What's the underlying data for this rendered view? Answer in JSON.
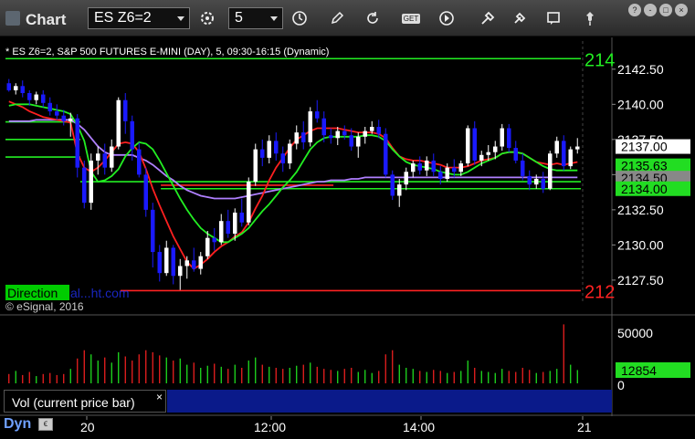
{
  "app": {
    "title": "Chart"
  },
  "toolbar": {
    "symbol_value": "ES Z6=2",
    "interval_value": "5",
    "icons": [
      "settings-icon",
      "clock-icon",
      "pencil-icon",
      "refresh-icon",
      "get-icon",
      "play-icon",
      "tools-icon",
      "comment-icon",
      "pin-icon"
    ],
    "get_label": "GET",
    "window_controls": [
      "?",
      "-",
      "□",
      "×"
    ]
  },
  "chart_header": "* ES Z6=2, S&P 500 FUTURES E-MINI (DAY), 5, 09:30-16:15 (Dynamic)",
  "copyright": "© eSignal, 2016",
  "watermark": {
    "box": "Direction",
    "rest": "al...ht.com"
  },
  "price_axis": {
    "ticks": [
      "2142.50",
      "2140.00",
      "2137.50",
      "2135.00",
      "2132.50",
      "2130.00",
      "2127.50"
    ],
    "tick_values": [
      2142.5,
      2140,
      2137.5,
      2135,
      2132.5,
      2130,
      2127.5
    ]
  },
  "price_tags": [
    {
      "label": "2137.00",
      "value": 2137.0,
      "bg": "#ffffff",
      "fg": "#000000"
    },
    {
      "label": "2135.63",
      "value": 2135.63,
      "bg": "#22dd22",
      "fg": "#000000"
    },
    {
      "label": "2134.50",
      "value": 2134.75,
      "bg": "#888888",
      "fg": "#000000"
    },
    {
      "label": "2134.00",
      "value": 2134.0,
      "bg": "#22dd22",
      "fg": "#000000"
    }
  ],
  "right_edge_labels": [
    {
      "label": "214",
      "value": 2143.25,
      "color": "#22ee22"
    },
    {
      "label": "212",
      "value": 2126.75,
      "color": "#ff2222"
    }
  ],
  "volume_axis": {
    "ticks": [
      "50000",
      "0"
    ],
    "current_label": "12854",
    "current_value": 12854
  },
  "vol_title": "Vol (current price bar)",
  "vol_close": "×",
  "time_axis": {
    "labels": [
      "20",
      "12:00",
      "14:00",
      "21"
    ]
  },
  "dyn_label": "Dyn",
  "colors": {
    "up": "#ffffff",
    "down": "#1a1aff",
    "ma_red": "#ff2020",
    "ma_green": "#22ee22",
    "ma_violet": "#b080ff",
    "ma_gray": "#aaaaaa",
    "level_green": "#22ee22",
    "level_red": "#ff2222"
  },
  "chart_data": {
    "type": "candlestick",
    "price_range": [
      2126.0,
      2144.5
    ],
    "volume_range": [
      0,
      60000
    ],
    "levels": [
      {
        "value": 2143.25,
        "color": "#22ee22",
        "from": 0.0
      },
      {
        "value": 2126.75,
        "color": "#ff2222",
        "from": 0.2
      },
      {
        "value": 2138.75,
        "color": "#22ee22",
        "from": 0.0,
        "to": 0.13
      },
      {
        "value": 2137.5,
        "color": "#22ee22",
        "from": 0.0,
        "to": 0.13
      },
      {
        "value": 2136.25,
        "color": "#22ee22",
        "from": 0.0,
        "to": 0.13
      },
      {
        "value": 2134.5,
        "color": "#22ee22",
        "from": 0.13
      },
      {
        "value": 2134.0,
        "color": "#22ee22",
        "from": 0.27
      },
      {
        "value": 2134.25,
        "color": "#ff2222",
        "from": 0.27,
        "to": 0.57
      }
    ],
    "bars": [
      [
        2141.5,
        2141.8,
        2140.9,
        2141.0
      ],
      [
        2141.0,
        2141.5,
        2140.7,
        2141.3
      ],
      [
        2141.3,
        2141.7,
        2140.5,
        2140.8
      ],
      [
        2140.8,
        2141.0,
        2139.9,
        2140.3
      ],
      [
        2140.3,
        2140.9,
        2140.0,
        2140.7
      ],
      [
        2140.7,
        2141.0,
        2139.8,
        2140.1
      ],
      [
        2140.1,
        2140.5,
        2139.2,
        2139.5
      ],
      [
        2139.5,
        2140.0,
        2138.9,
        2139.2
      ],
      [
        2139.2,
        2139.6,
        2138.5,
        2138.8
      ],
      [
        2138.8,
        2139.4,
        2137.7,
        2139.0
      ],
      [
        2139.0,
        2139.3,
        2134.8,
        2135.5
      ],
      [
        2135.5,
        2136.0,
        2132.6,
        2133.0
      ],
      [
        2133.0,
        2136.5,
        2132.5,
        2136.0
      ],
      [
        2136.0,
        2137.0,
        2135.0,
        2136.5
      ],
      [
        2136.5,
        2137.2,
        2135.0,
        2135.5
      ],
      [
        2135.5,
        2137.5,
        2135.2,
        2137.0
      ],
      [
        2137.0,
        2140.5,
        2136.8,
        2140.3
      ],
      [
        2140.3,
        2140.8,
        2137.9,
        2138.8
      ],
      [
        2138.8,
        2139.2,
        2136.0,
        2136.8
      ],
      [
        2136.8,
        2137.3,
        2134.8,
        2135.0
      ],
      [
        2135.0,
        2135.5,
        2132.0,
        2132.5
      ],
      [
        2132.5,
        2133.0,
        2128.4,
        2129.5
      ],
      [
        2129.5,
        2130.0,
        2127.4,
        2128.0
      ],
      [
        2128.0,
        2130.3,
        2127.8,
        2129.8
      ],
      [
        2129.8,
        2130.0,
        2127.2,
        2127.8
      ],
      [
        2127.8,
        2129.0,
        2126.8,
        2128.5
      ],
      [
        2128.5,
        2129.2,
        2127.6,
        2128.9
      ],
      [
        2128.9,
        2129.8,
        2128.1,
        2128.3
      ],
      [
        2128.3,
        2129.5,
        2127.9,
        2129.2
      ],
      [
        2129.2,
        2131.0,
        2129.0,
        2130.5
      ],
      [
        2130.5,
        2131.2,
        2129.6,
        2130.2
      ],
      [
        2130.2,
        2132.2,
        2130.0,
        2131.7
      ],
      [
        2131.7,
        2132.5,
        2130.5,
        2130.8
      ],
      [
        2130.8,
        2132.6,
        2130.3,
        2132.3
      ],
      [
        2132.3,
        2133.3,
        2131.3,
        2131.6
      ],
      [
        2131.6,
        2134.8,
        2131.4,
        2134.5
      ],
      [
        2134.5,
        2137.2,
        2134.2,
        2136.8
      ],
      [
        2136.8,
        2137.5,
        2135.6,
        2136.2
      ],
      [
        2136.2,
        2137.8,
        2135.8,
        2137.4
      ],
      [
        2137.4,
        2138.0,
        2136.0,
        2136.5
      ],
      [
        2136.5,
        2137.0,
        2135.2,
        2135.8
      ],
      [
        2135.8,
        2137.5,
        2135.4,
        2137.2
      ],
      [
        2137.2,
        2138.5,
        2136.8,
        2138.0
      ],
      [
        2138.0,
        2138.8,
        2136.8,
        2137.3
      ],
      [
        2137.3,
        2139.8,
        2137.0,
        2139.5
      ],
      [
        2139.5,
        2140.3,
        2138.7,
        2139.0
      ],
      [
        2139.0,
        2139.5,
        2137.3,
        2137.8
      ],
      [
        2137.8,
        2138.3,
        2137.2,
        2137.6
      ],
      [
        2137.6,
        2138.4,
        2137.1,
        2138.1
      ],
      [
        2138.1,
        2138.5,
        2137.5,
        2137.8
      ],
      [
        2137.8,
        2138.3,
        2136.7,
        2137.0
      ],
      [
        2137.0,
        2138.0,
        2136.2,
        2137.7
      ],
      [
        2137.7,
        2138.4,
        2137.2,
        2138.1
      ],
      [
        2138.1,
        2138.8,
        2137.9,
        2138.4
      ],
      [
        2138.4,
        2138.9,
        2137.6,
        2137.9
      ],
      [
        2137.9,
        2138.3,
        2134.8,
        2135.0
      ],
      [
        2135.0,
        2135.3,
        2133.2,
        2133.5
      ],
      [
        2133.5,
        2134.7,
        2132.7,
        2134.3
      ],
      [
        2134.3,
        2135.5,
        2133.9,
        2135.2
      ],
      [
        2135.2,
        2136.0,
        2134.8,
        2135.8
      ],
      [
        2135.8,
        2136.3,
        2135.0,
        2135.3
      ],
      [
        2135.3,
        2136.3,
        2134.9,
        2136.0
      ],
      [
        2136.0,
        2136.5,
        2134.9,
        2135.2
      ],
      [
        2135.2,
        2135.6,
        2134.3,
        2134.7
      ],
      [
        2134.7,
        2135.8,
        2134.5,
        2135.5
      ],
      [
        2135.5,
        2136.1,
        2134.8,
        2135.2
      ],
      [
        2135.2,
        2136.0,
        2134.9,
        2135.8
      ],
      [
        2135.8,
        2138.5,
        2135.6,
        2138.3
      ],
      [
        2138.3,
        2138.8,
        2135.7,
        2136.0
      ],
      [
        2136.0,
        2136.7,
        2135.6,
        2136.4
      ],
      [
        2136.4,
        2137.1,
        2136.0,
        2136.6
      ],
      [
        2136.6,
        2137.4,
        2136.1,
        2137.0
      ],
      [
        2137.0,
        2138.6,
        2136.7,
        2138.3
      ],
      [
        2138.3,
        2138.6,
        2136.6,
        2136.9
      ],
      [
        2136.9,
        2137.4,
        2135.8,
        2136.0
      ],
      [
        2136.0,
        2136.5,
        2134.6,
        2134.9
      ],
      [
        2134.9,
        2135.3,
        2133.9,
        2134.3
      ],
      [
        2134.3,
        2135.0,
        2134.0,
        2134.7
      ],
      [
        2134.7,
        2135.2,
        2133.7,
        2134.0
      ],
      [
        2134.0,
        2136.7,
        2133.9,
        2136.5
      ],
      [
        2136.5,
        2137.7,
        2136.2,
        2137.4
      ],
      [
        2137.4,
        2137.8,
        2135.3,
        2135.6
      ],
      [
        2135.6,
        2137.0,
        2135.4,
        2136.8
      ],
      [
        2136.8,
        2137.6,
        2136.5,
        2137.0
      ]
    ],
    "ma_red": [
      2140.2,
      2140.0,
      2139.8,
      2139.5,
      2139.3,
      2139.1,
      2139.0,
      2138.9,
      2138.8,
      2138.7,
      2136.5,
      2135.5,
      2135.2,
      2135.5,
      2136.0,
      2136.6,
      2137.2,
      2137.3,
      2137.2,
      2136.6,
      2135.4,
      2134.0,
      2132.8,
      2131.7,
      2130.6,
      2129.7,
      2128.8,
      2128.3,
      2128.6,
      2129.0,
      2129.5,
      2129.9,
      2130.2,
      2130.6,
      2130.9,
      2131.6,
      2132.6,
      2133.5,
      2134.6,
      2135.5,
      2136.2,
      2136.9,
      2137.5,
      2137.8,
      2138.1,
      2138.3,
      2138.3,
      2138.3,
      2138.3,
      2138.2,
      2138.1,
      2138.0,
      2138.0,
      2138.0,
      2137.9,
      2137.6,
      2136.9,
      2136.3,
      2136.1,
      2136.0,
      2136.0,
      2135.9,
      2135.8,
      2135.7,
      2135.5,
      2135.5,
      2135.5,
      2135.6,
      2135.8,
      2136.0,
      2136.1,
      2136.2,
      2136.5,
      2136.6,
      2136.6,
      2136.5,
      2136.2,
      2135.9,
      2135.8,
      2135.7,
      2135.8,
      2135.7,
      2135.8,
      2135.9
    ],
    "ma_green": [
      2139.9,
      2140.0,
      2140.0,
      2140.0,
      2139.9,
      2139.8,
      2139.7,
      2139.6,
      2139.5,
      2139.3,
      2138.5,
      2137.4,
      2135.2,
      2134.5,
      2134.6,
      2134.9,
      2135.4,
      2136.3,
      2136.9,
      2137.3,
      2137.2,
      2136.8,
      2136.0,
      2135.1,
      2134.2,
      2133.3,
      2132.5,
      2131.8,
      2131.2,
      2130.8,
      2130.5,
      2130.2,
      2130.2,
      2130.5,
      2130.8,
      2131.2,
      2131.8,
      2132.4,
      2132.9,
      2133.5,
      2134.1,
      2134.6,
      2135.2,
      2136.0,
      2136.8,
      2137.3,
      2137.6,
      2137.7,
      2137.7,
      2137.7,
      2137.7,
      2137.7,
      2137.8,
      2137.8,
      2137.7,
      2137.4,
      2136.8,
      2136.3,
      2135.9,
      2135.7,
      2135.6,
      2135.5,
      2135.4,
      2135.2,
      2135.1,
      2135.0,
      2135.0,
      2135.2,
      2135.5,
      2135.8,
      2136.0,
      2136.2,
      2136.5,
      2136.6,
      2136.6,
      2136.5,
      2136.2,
      2135.9,
      2135.6,
      2135.4,
      2135.3,
      2135.3,
      2135.3,
      2135.3
    ],
    "ma_violet": [
      2138.8,
      2138.8,
      2138.8,
      2138.8,
      2138.9,
      2138.9,
      2138.9,
      2138.9,
      2138.9,
      2138.9,
      2138.6,
      2138.2,
      2137.6,
      2137.0,
      2136.6,
      2136.4,
      2136.4,
      2136.4,
      2136.4,
      2136.2,
      2136.0,
      2135.7,
      2135.3,
      2134.9,
      2134.6,
      2134.2,
      2133.9,
      2133.7,
      2133.5,
      2133.4,
      2133.3,
      2133.3,
      2133.3,
      2133.3,
      2133.4,
      2133.5,
      2133.6,
      2133.7,
      2133.8,
      2133.9,
      2134.0,
      2134.1,
      2134.2,
      2134.3,
      2134.4,
      2134.5,
      2134.5,
      2134.6,
      2134.6,
      2134.6,
      2134.7,
      2134.7,
      2134.8,
      2134.8,
      2134.8,
      2134.8,
      2134.8,
      2134.8,
      2134.8,
      2134.8,
      2134.8,
      2134.8,
      2134.8,
      2134.8,
      2134.8,
      2134.8,
      2134.8,
      2134.8,
      2134.8,
      2134.8,
      2134.8,
      2134.8,
      2134.8,
      2134.8,
      2134.8,
      2134.8,
      2134.8,
      2134.8,
      2134.8,
      2134.8,
      2134.8,
      2134.8,
      2134.8,
      2134.8
    ],
    "volume": [
      9000,
      12000,
      8000,
      11000,
      7000,
      9000,
      10000,
      8000,
      9000,
      14000,
      24000,
      32000,
      28000,
      22000,
      25000,
      20000,
      30000,
      26000,
      22000,
      28000,
      32000,
      30000,
      27000,
      25000,
      22000,
      24000,
      18000,
      20000,
      15000,
      17000,
      19000,
      16000,
      14000,
      18000,
      15000,
      22000,
      25000,
      18000,
      16000,
      15000,
      14000,
      15000,
      17000,
      18000,
      20000,
      16000,
      14000,
      13000,
      12000,
      14000,
      15000,
      11000,
      13000,
      10000,
      12000,
      28000,
      32000,
      18000,
      15000,
      14000,
      12000,
      11000,
      13000,
      12000,
      10000,
      11000,
      12000,
      22000,
      15000,
      12000,
      11000,
      10000,
      14000,
      12000,
      11000,
      15000,
      13000,
      10000,
      11000,
      12000,
      14000,
      57000,
      18000,
      12854
    ]
  }
}
